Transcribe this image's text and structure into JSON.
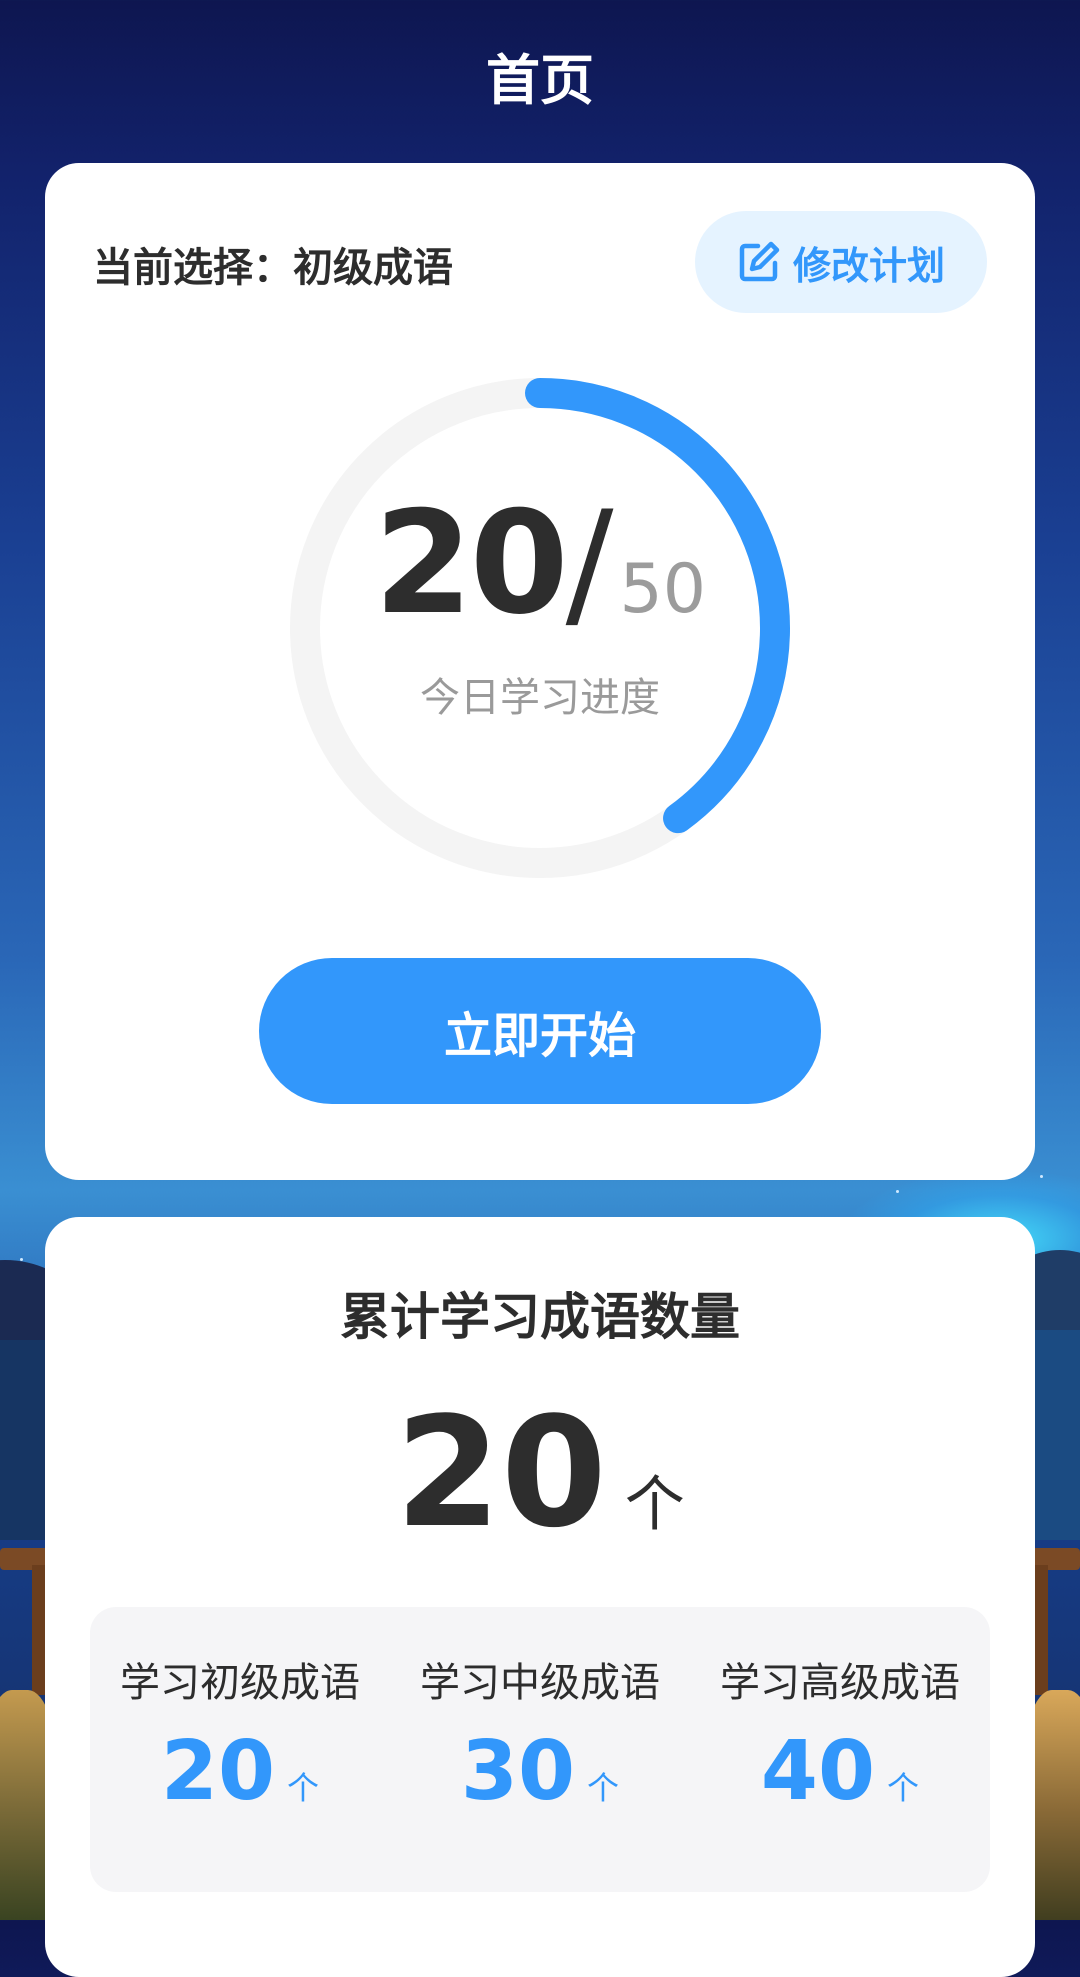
{
  "app": {
    "title": "首页"
  },
  "plan": {
    "selection_label": "当前选择：",
    "selection_value": "初级成语",
    "edit_button_label": "修改计划",
    "edit_icon": "edit-icon",
    "progress": {
      "done": "20",
      "slash": "/",
      "goal": "50",
      "label": "今日学习进度"
    },
    "start_button_label": "立即开始"
  },
  "stats": {
    "title": "累计学习成语数量",
    "total_value": "20",
    "total_unit": "个",
    "levels": [
      {
        "label": "学习初级成语",
        "value": "20",
        "unit": "个"
      },
      {
        "label": "学习中级成语",
        "value": "30",
        "unit": "个"
      },
      {
        "label": "学习高级成语",
        "value": "40",
        "unit": "个"
      }
    ]
  },
  "colors": {
    "accent": "#3297fb",
    "accent_light": "#e5f3ff",
    "ring_track": "#f4f4f4",
    "text_dark": "#2d2d2d",
    "text_gray": "#9a9a9a"
  }
}
